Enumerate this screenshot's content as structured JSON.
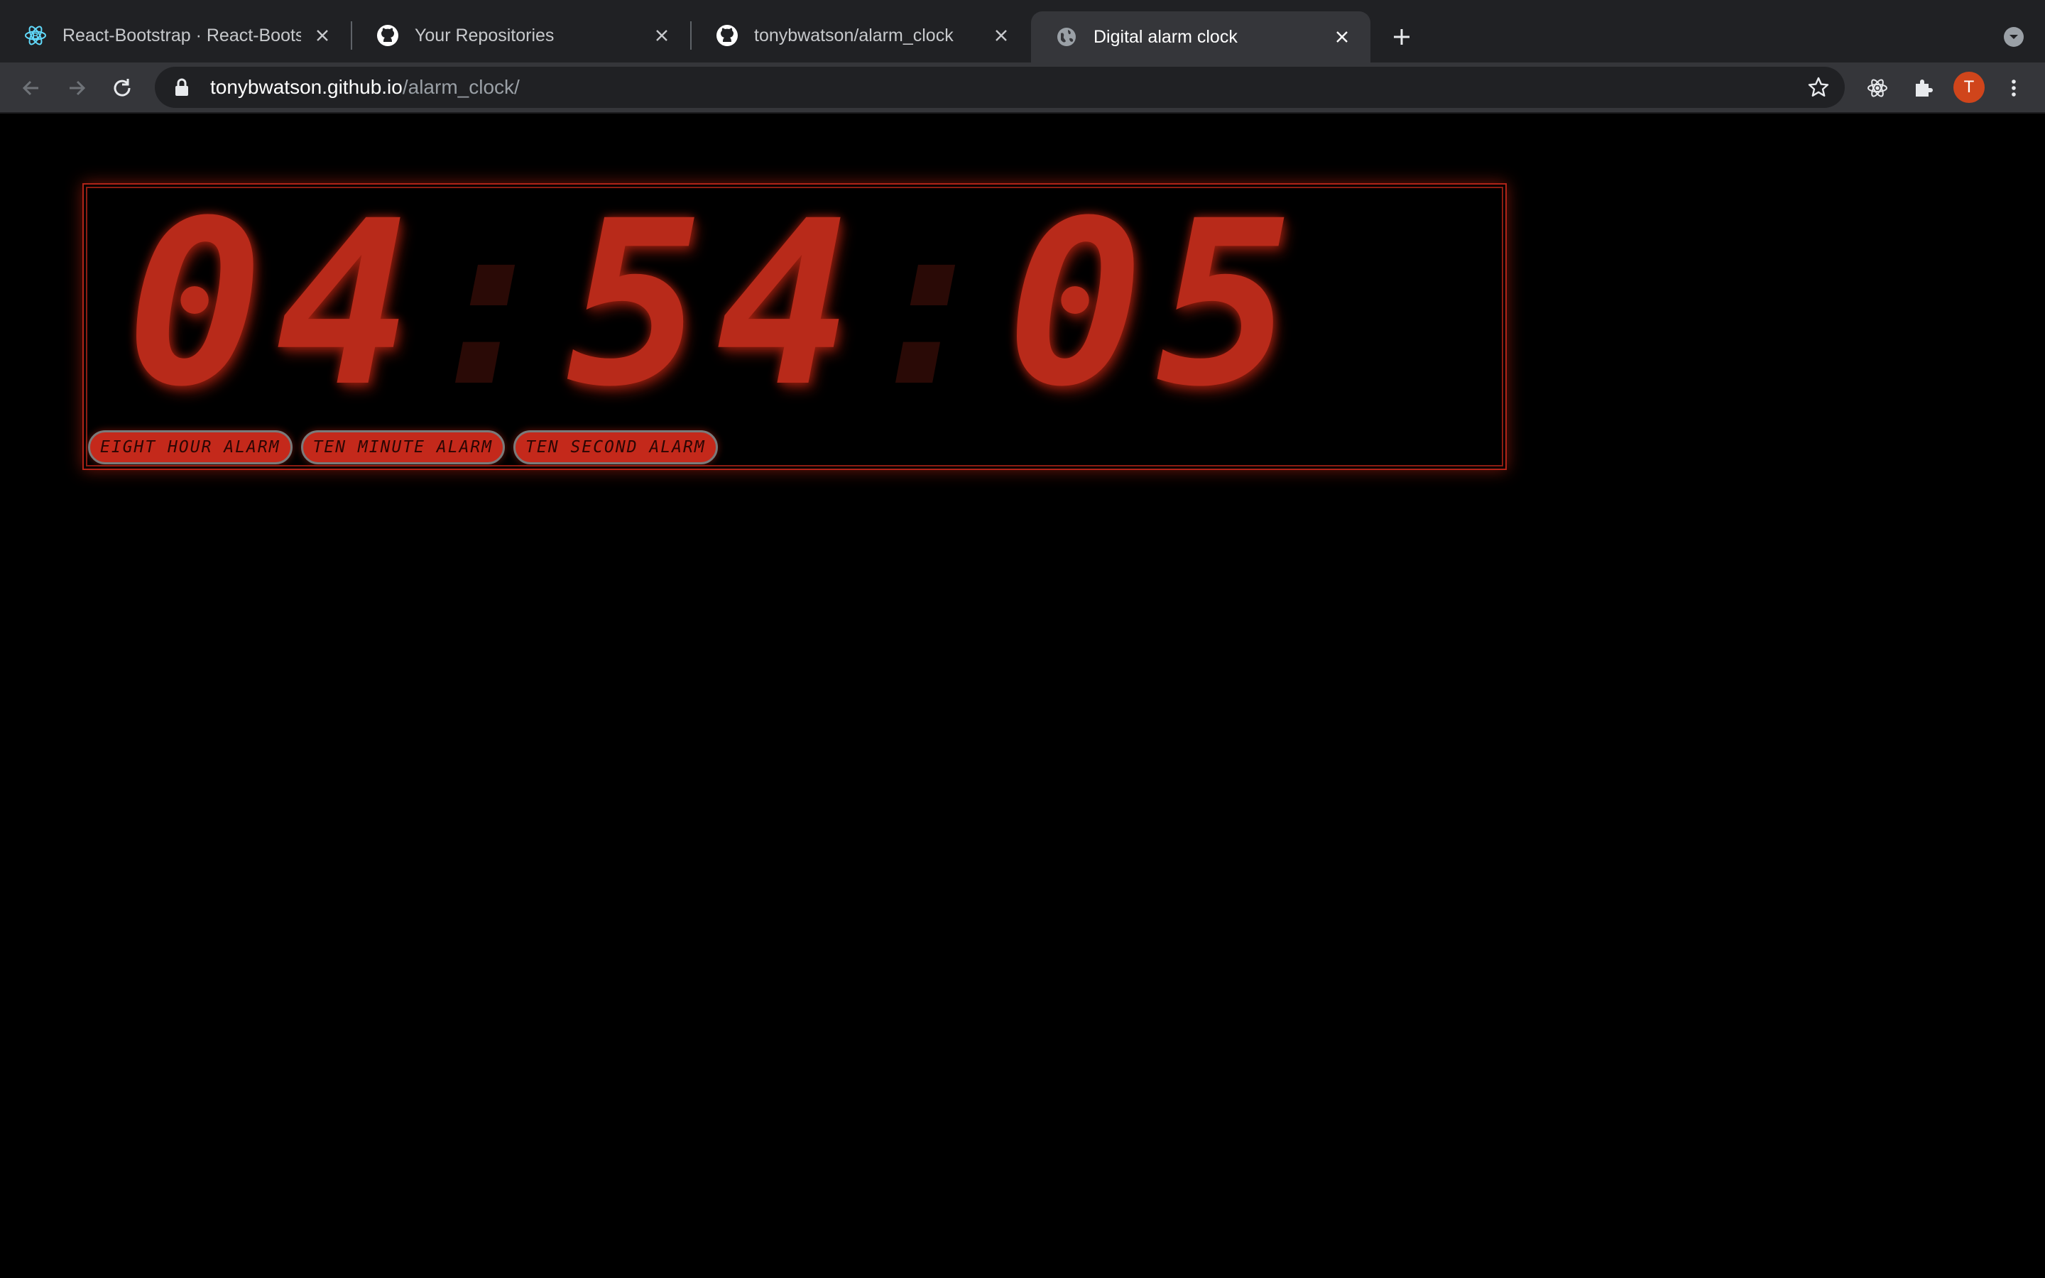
{
  "browser": {
    "tabs": [
      {
        "title": "React-Bootstrap · React-Boots",
        "favicon": "react-bootstrap-icon",
        "active": false
      },
      {
        "title": "Your Repositories",
        "favicon": "github-icon",
        "active": false
      },
      {
        "title": "tonybwatson/alarm_clock",
        "favicon": "github-icon",
        "active": false
      },
      {
        "title": "Digital alarm clock",
        "favicon": "globe-icon",
        "active": true
      }
    ],
    "url_host": "tonybwatson.github.io",
    "url_path": "/alarm_clock/",
    "profile_initial": "T",
    "colors": {
      "tabstrip": "#202124",
      "toolbar": "#35363a",
      "avatar": "#d0451b"
    }
  },
  "clock": {
    "hours": "04",
    "minutes": "54",
    "seconds": "05",
    "separator": ":",
    "color": "#b82a1a"
  },
  "alarms": {
    "eight_hour_label": "EIGHT HOUR ALARM",
    "ten_minute_label": "TEN MINUTE ALARM",
    "ten_second_label": "TEN SECOND ALARM"
  }
}
